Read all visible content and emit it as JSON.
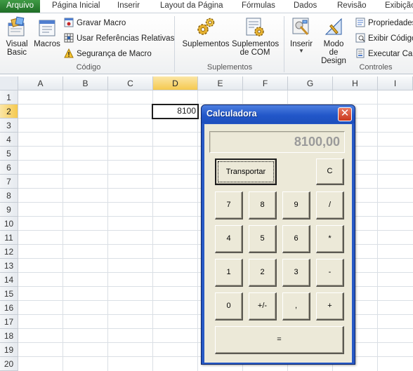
{
  "ribbon": {
    "tabs": [
      "Arquivo",
      "Página Inicial",
      "Inserir",
      "Layout da Página",
      "Fórmulas",
      "Dados",
      "Revisão",
      "Exibição"
    ],
    "codigo": {
      "visual_basic": "Visual Basic",
      "macros": "Macros",
      "gravar_macro": "Gravar Macro",
      "usar_referencias": "Usar Referências Relativas",
      "seguranca": "Segurança de Macro",
      "label": "Código"
    },
    "suplementos": {
      "suplementos": "Suplementos",
      "suplementos_com": "Suplementos de COM",
      "label": "Suplementos"
    },
    "controles": {
      "inserir": "Inserir",
      "modo_design": "Modo de Design",
      "propriedades": "Propriedades",
      "exibir_codigo": "Exibir Código",
      "executar_caixa": "Executar Caixa",
      "label": "Controles"
    }
  },
  "sheet": {
    "columns": [
      "A",
      "B",
      "C",
      "D",
      "E",
      "F",
      "G",
      "H",
      "I"
    ],
    "rows": [
      "1",
      "2",
      "3",
      "4",
      "5",
      "6",
      "7",
      "8",
      "9",
      "10",
      "11",
      "12",
      "13",
      "14",
      "15",
      "16",
      "17",
      "18",
      "19",
      "20"
    ],
    "selected_column": "D",
    "selected_row": "2",
    "active_cell_value": "8100"
  },
  "calculator": {
    "title": "Calculadora",
    "close": "✕",
    "display": "8100,00",
    "transport": "Transportar",
    "clear": "C",
    "keys": {
      "k7": "7",
      "k8": "8",
      "k9": "9",
      "div": "/",
      "k4": "4",
      "k5": "5",
      "k6": "6",
      "mul": "*",
      "k1": "1",
      "k2": "2",
      "k3": "3",
      "sub": "-",
      "k0": "0",
      "sign": "+/-",
      "comma": ",",
      "add": "+",
      "equals": "="
    }
  },
  "colors": {
    "file_tab": "#2e7d32",
    "title_bar": "#2257c9",
    "dialog_face": "#ece9d8",
    "selection": "#f5c94f"
  },
  "icons": [
    "visual-basic-icon",
    "macros-icon",
    "record-macro-icon",
    "relative-references-icon",
    "macro-security-warning-icon",
    "add-ins-gear-icon",
    "com-add-ins-icon",
    "insert-controls-icon",
    "design-mode-icon",
    "properties-icon",
    "view-code-icon",
    "run-dialog-icon"
  ]
}
